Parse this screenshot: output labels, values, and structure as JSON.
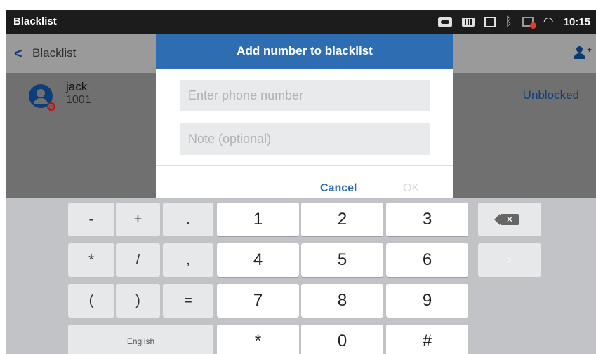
{
  "status_bar": {
    "title": "Blacklist",
    "time": "10:15",
    "icons": [
      "voicemail-icon",
      "keyboard-icon",
      "screenshot-icon",
      "bluetooth-icon",
      "network-error-icon",
      "wifi-icon"
    ]
  },
  "app_bar": {
    "back_label": "Blacklist",
    "back_icon": "chevron-left-icon",
    "action_icon": "add-contact-icon"
  },
  "list": [
    {
      "name": "jack",
      "number": "1001",
      "status": "Unblocked"
    }
  ],
  "dialog": {
    "title": "Add number to blacklist",
    "phone_placeholder": "Enter phone number",
    "note_placeholder": "Note (optional)",
    "cancel_label": "Cancel",
    "ok_label": "OK"
  },
  "keyboard": {
    "row1": [
      "-",
      "+",
      ".",
      "1",
      "2",
      "3"
    ],
    "row2": [
      "*",
      "/",
      ",",
      "4",
      "5",
      "6"
    ],
    "row3": [
      "(",
      ")",
      "=",
      "7",
      "8",
      "9"
    ],
    "row4": [
      "English",
      "*",
      "0",
      "#"
    ],
    "backspace_icon": "backspace-icon",
    "next_icon": "chevron-right-icon"
  },
  "colors": {
    "accent": "#2f6db2",
    "status_bar": "#1c1c1c",
    "link": "#0c3f80"
  }
}
